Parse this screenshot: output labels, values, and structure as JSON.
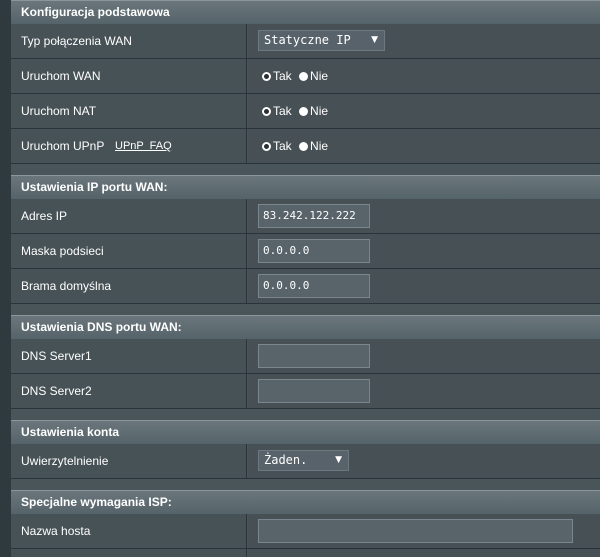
{
  "basic": {
    "title": "Konfiguracja podstawowa",
    "wan_type": {
      "label": "Typ połączenia WAN",
      "value": "Statyczne IP"
    },
    "enable_wan": {
      "label": "Uruchom WAN",
      "yes": "Tak",
      "no": "Nie",
      "selected": "Tak"
    },
    "enable_nat": {
      "label": "Uruchom NAT",
      "yes": "Tak",
      "no": "Nie",
      "selected": "Tak"
    },
    "enable_upnp": {
      "label": "Uruchom UPnP",
      "faq": "UPnP  FAQ",
      "yes": "Tak",
      "no": "Nie",
      "selected": "Tak"
    }
  },
  "wan_ip": {
    "title": "Ustawienia IP portu WAN:",
    "ip": {
      "label": "Adres IP",
      "value": "83.242.122.222"
    },
    "mask": {
      "label": "Maska podsieci",
      "value": "0.0.0.0"
    },
    "gateway": {
      "label": "Brama domyślna",
      "value": "0.0.0.0"
    }
  },
  "wan_dns": {
    "title": "Ustawienia DNS portu WAN:",
    "dns1": {
      "label": "DNS Server1",
      "value": ""
    },
    "dns2": {
      "label": "DNS Server2",
      "value": ""
    }
  },
  "account": {
    "title": "Ustawienia konta",
    "auth": {
      "label": "Uwierzytelnienie",
      "value": "Żaden."
    }
  },
  "isp": {
    "title": "Specjalne wymagania ISP:",
    "hostname": {
      "label": "Nazwa hosta",
      "value": ""
    }
  }
}
